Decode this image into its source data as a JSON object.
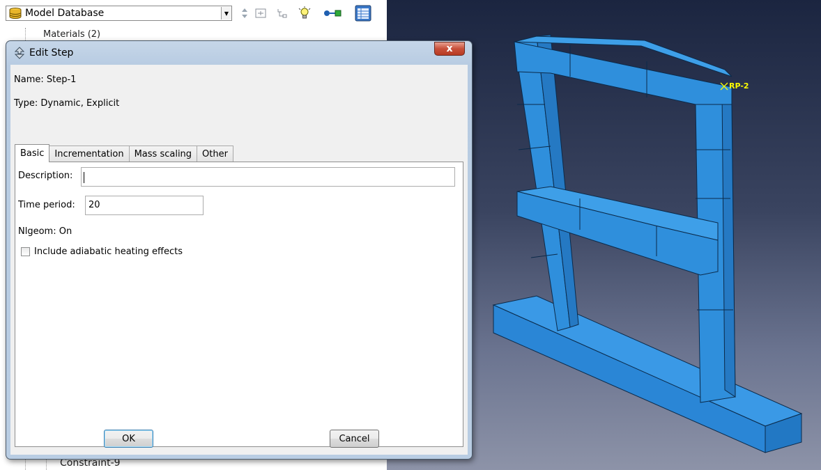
{
  "tree": {
    "model_db_label": "Model Database",
    "top_row_text": "Materials (2)",
    "bottom_row_text": "Constraint-9"
  },
  "viewport": {
    "reference_point_label": "RP-2"
  },
  "dialog": {
    "title": "Edit Step",
    "close_glyph": "x",
    "name_line": "Name:  Step-1",
    "type_line": "Type:  Dynamic, Explicit",
    "tabs": [
      {
        "label": "Basic",
        "active": true
      },
      {
        "label": "Incrementation",
        "active": false
      },
      {
        "label": "Mass scaling",
        "active": false
      },
      {
        "label": "Other",
        "active": false
      }
    ],
    "basic": {
      "description_label": "Description:",
      "description_value": "",
      "time_period_label": "Time period:",
      "time_period_value": "20",
      "nlgeom_text": "Nlgeom:  On",
      "adiabatic_label": "Include adiabatic heating effects",
      "adiabatic_checked": false
    },
    "ok_label": "OK",
    "cancel_label": "Cancel"
  },
  "colors": {
    "part_fill": "#2f8fdc",
    "part_edge": "#0b2a4a",
    "reference_point": "#ffff00"
  }
}
